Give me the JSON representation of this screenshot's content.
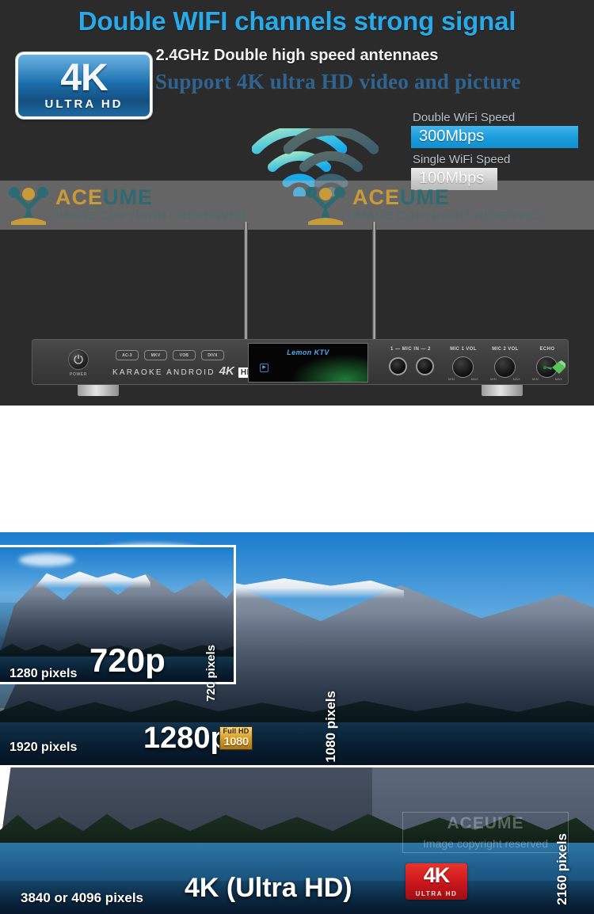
{
  "wifi_section": {
    "headline": "Double WIFI channels strong signal",
    "subheadline": "2.4GHz Double high speed antennaes",
    "headline_color": "#29a9e8",
    "speed_legend": [
      {
        "caption": "Double WiFi Speed",
        "value": "300Mbps",
        "bar_color": "#1a9ad8",
        "bar_kind": "double"
      },
      {
        "caption": "Single WiFi Speed",
        "value": "100Mbps",
        "bar_color": "#cfcfcf",
        "bar_kind": "single"
      }
    ],
    "wifi_icon_strong": "wifi-signal-icon",
    "wifi_icon_weak": "wifi-signal-dim-icon",
    "watermark": {
      "brand_part_a": "ACE",
      "brand_part_b": "UME",
      "sub": "IMAGE COPYRIGHT RESERVED"
    },
    "device": {
      "power_label": "POWER",
      "power_glyph": "power-icon",
      "logo_badges": [
        "AC-3",
        "MKV",
        "VOB",
        "DIVX"
      ],
      "wordmark_prefix": "KARAOKE ANDROID",
      "wordmark_4k": "4K",
      "wordmark_hd": "HD",
      "screen_title": "Lemon KTV",
      "mic_in_label": "1 — MIC IN — 2",
      "knobs": [
        {
          "label": "MIC 1 VOL",
          "min": "MIN",
          "max": "MAX"
        },
        {
          "label": "MIC 2 VOL",
          "min": "MIN",
          "max": "MAX"
        },
        {
          "label": "ECHO",
          "min": "MIN",
          "max": "MAX"
        }
      ],
      "remote_icon": "remote-control-icon"
    }
  },
  "showcase_section": {
    "badge_4k": {
      "title": "4K",
      "subtitle": "ULTRA HD"
    },
    "headline": "Support 4K ultra HD video and picture",
    "headline_color": "#2f6390",
    "resolutions": [
      {
        "name": "720p",
        "width_label": "1280 pixels",
        "height_label": "720 pixels"
      },
      {
        "name": "1280p",
        "width_label": "1920 pixels",
        "height_label": "1080 pixels"
      },
      {
        "name": "4K (Ultra HD)",
        "width_label": "3840 or 4096 pixels",
        "height_label": "2160 pixels"
      }
    ],
    "fullhd_badge": {
      "top": "Full HD",
      "number": "1080"
    },
    "ultrahd_badge": {
      "title": "4K",
      "subtitle": "ULTRA HD"
    },
    "watermark": {
      "brand": "ACEUME",
      "sub": "Image copyright reserved"
    }
  }
}
